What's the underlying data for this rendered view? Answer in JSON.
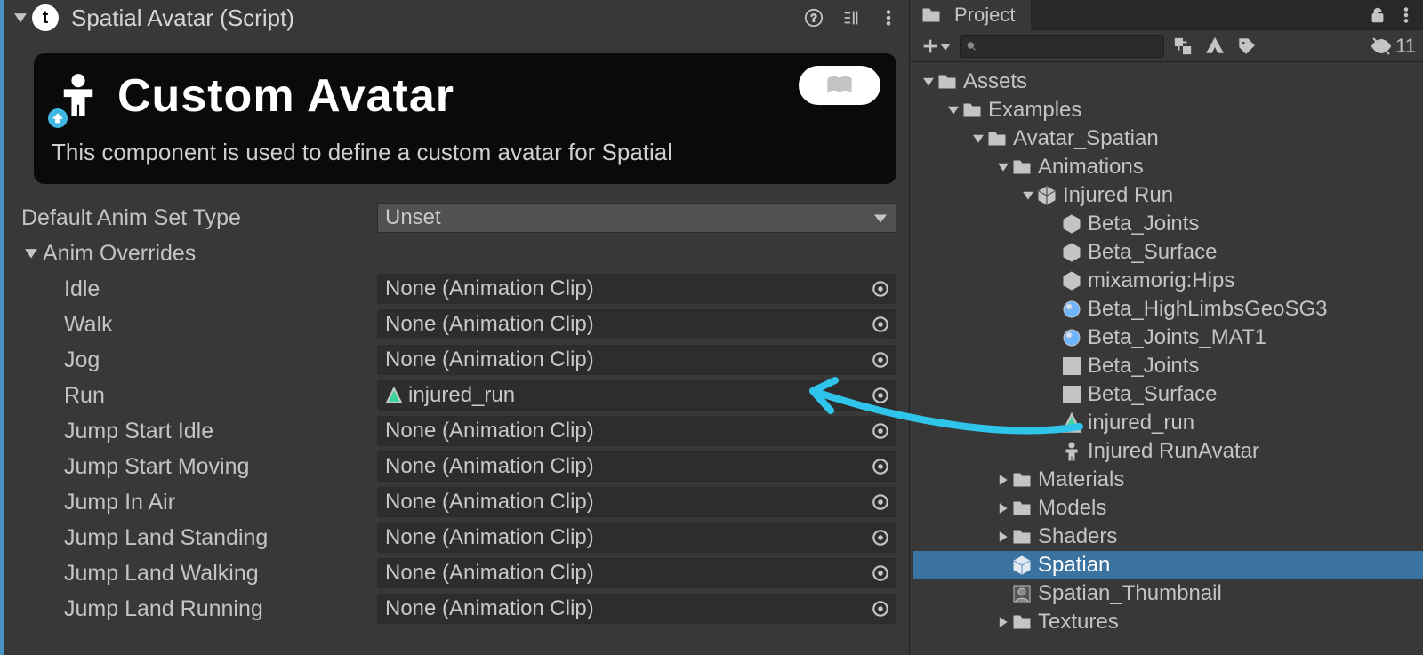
{
  "inspector": {
    "component_title": "Spatial Avatar (Script)",
    "card": {
      "title": "Custom Avatar",
      "description": "This component is used to define a custom avatar for Spatial"
    },
    "default_anim_set_label": "Default Anim Set Type",
    "default_anim_set_value": "Unset",
    "anim_overrides_label": "Anim Overrides",
    "overrides": [
      {
        "label": "Idle",
        "value": "None (Animation Clip)",
        "is_clip": false
      },
      {
        "label": "Walk",
        "value": "None (Animation Clip)",
        "is_clip": false
      },
      {
        "label": "Jog",
        "value": "None (Animation Clip)",
        "is_clip": false
      },
      {
        "label": "Run",
        "value": "injured_run",
        "is_clip": true
      },
      {
        "label": "Jump Start Idle",
        "value": "None (Animation Clip)",
        "is_clip": false
      },
      {
        "label": "Jump Start Moving",
        "value": "None (Animation Clip)",
        "is_clip": false
      },
      {
        "label": "Jump In Air",
        "value": "None (Animation Clip)",
        "is_clip": false
      },
      {
        "label": "Jump Land Standing",
        "value": "None (Animation Clip)",
        "is_clip": false
      },
      {
        "label": "Jump Land Walking",
        "value": "None (Animation Clip)",
        "is_clip": false
      },
      {
        "label": "Jump Land Running",
        "value": "None (Animation Clip)",
        "is_clip": false
      }
    ]
  },
  "project": {
    "tab_label": "Project",
    "hidden_count": "11",
    "search_placeholder": "",
    "tree": [
      {
        "depth": 0,
        "fold": "open",
        "icon": "folder",
        "label": "Assets",
        "sel": false
      },
      {
        "depth": 1,
        "fold": "open",
        "icon": "folder",
        "label": "Examples",
        "sel": false
      },
      {
        "depth": 2,
        "fold": "open",
        "icon": "folder",
        "label": "Avatar_Spatian",
        "sel": false
      },
      {
        "depth": 3,
        "fold": "open",
        "icon": "folder",
        "label": "Animations",
        "sel": false
      },
      {
        "depth": 4,
        "fold": "open",
        "icon": "model",
        "label": "Injured Run",
        "sel": false
      },
      {
        "depth": 5,
        "fold": "none",
        "icon": "mesh",
        "label": "Beta_Joints",
        "sel": false
      },
      {
        "depth": 5,
        "fold": "none",
        "icon": "mesh",
        "label": "Beta_Surface",
        "sel": false
      },
      {
        "depth": 5,
        "fold": "none",
        "icon": "mesh",
        "label": "mixamorig:Hips",
        "sel": false
      },
      {
        "depth": 5,
        "fold": "none",
        "icon": "mat",
        "label": "Beta_HighLimbsGeoSG3",
        "sel": false
      },
      {
        "depth": 5,
        "fold": "none",
        "icon": "mat",
        "label": "Beta_Joints_MAT1",
        "sel": false
      },
      {
        "depth": 5,
        "fold": "none",
        "icon": "grid",
        "label": "Beta_Joints",
        "sel": false
      },
      {
        "depth": 5,
        "fold": "none",
        "icon": "grid",
        "label": "Beta_Surface",
        "sel": false
      },
      {
        "depth": 5,
        "fold": "none",
        "icon": "clip",
        "label": "injured_run",
        "sel": false
      },
      {
        "depth": 5,
        "fold": "none",
        "icon": "avatar",
        "label": "Injured RunAvatar",
        "sel": false
      },
      {
        "depth": 3,
        "fold": "closed",
        "icon": "folder",
        "label": "Materials",
        "sel": false
      },
      {
        "depth": 3,
        "fold": "closed",
        "icon": "folder",
        "label": "Models",
        "sel": false
      },
      {
        "depth": 3,
        "fold": "closed",
        "icon": "folder",
        "label": "Shaders",
        "sel": false
      },
      {
        "depth": 3,
        "fold": "none",
        "icon": "prefab",
        "label": "Spatian",
        "sel": true
      },
      {
        "depth": 3,
        "fold": "none",
        "icon": "thumb",
        "label": "Spatian_Thumbnail",
        "sel": false
      },
      {
        "depth": 3,
        "fold": "closed",
        "icon": "folder",
        "label": "Textures",
        "sel": false
      }
    ]
  }
}
